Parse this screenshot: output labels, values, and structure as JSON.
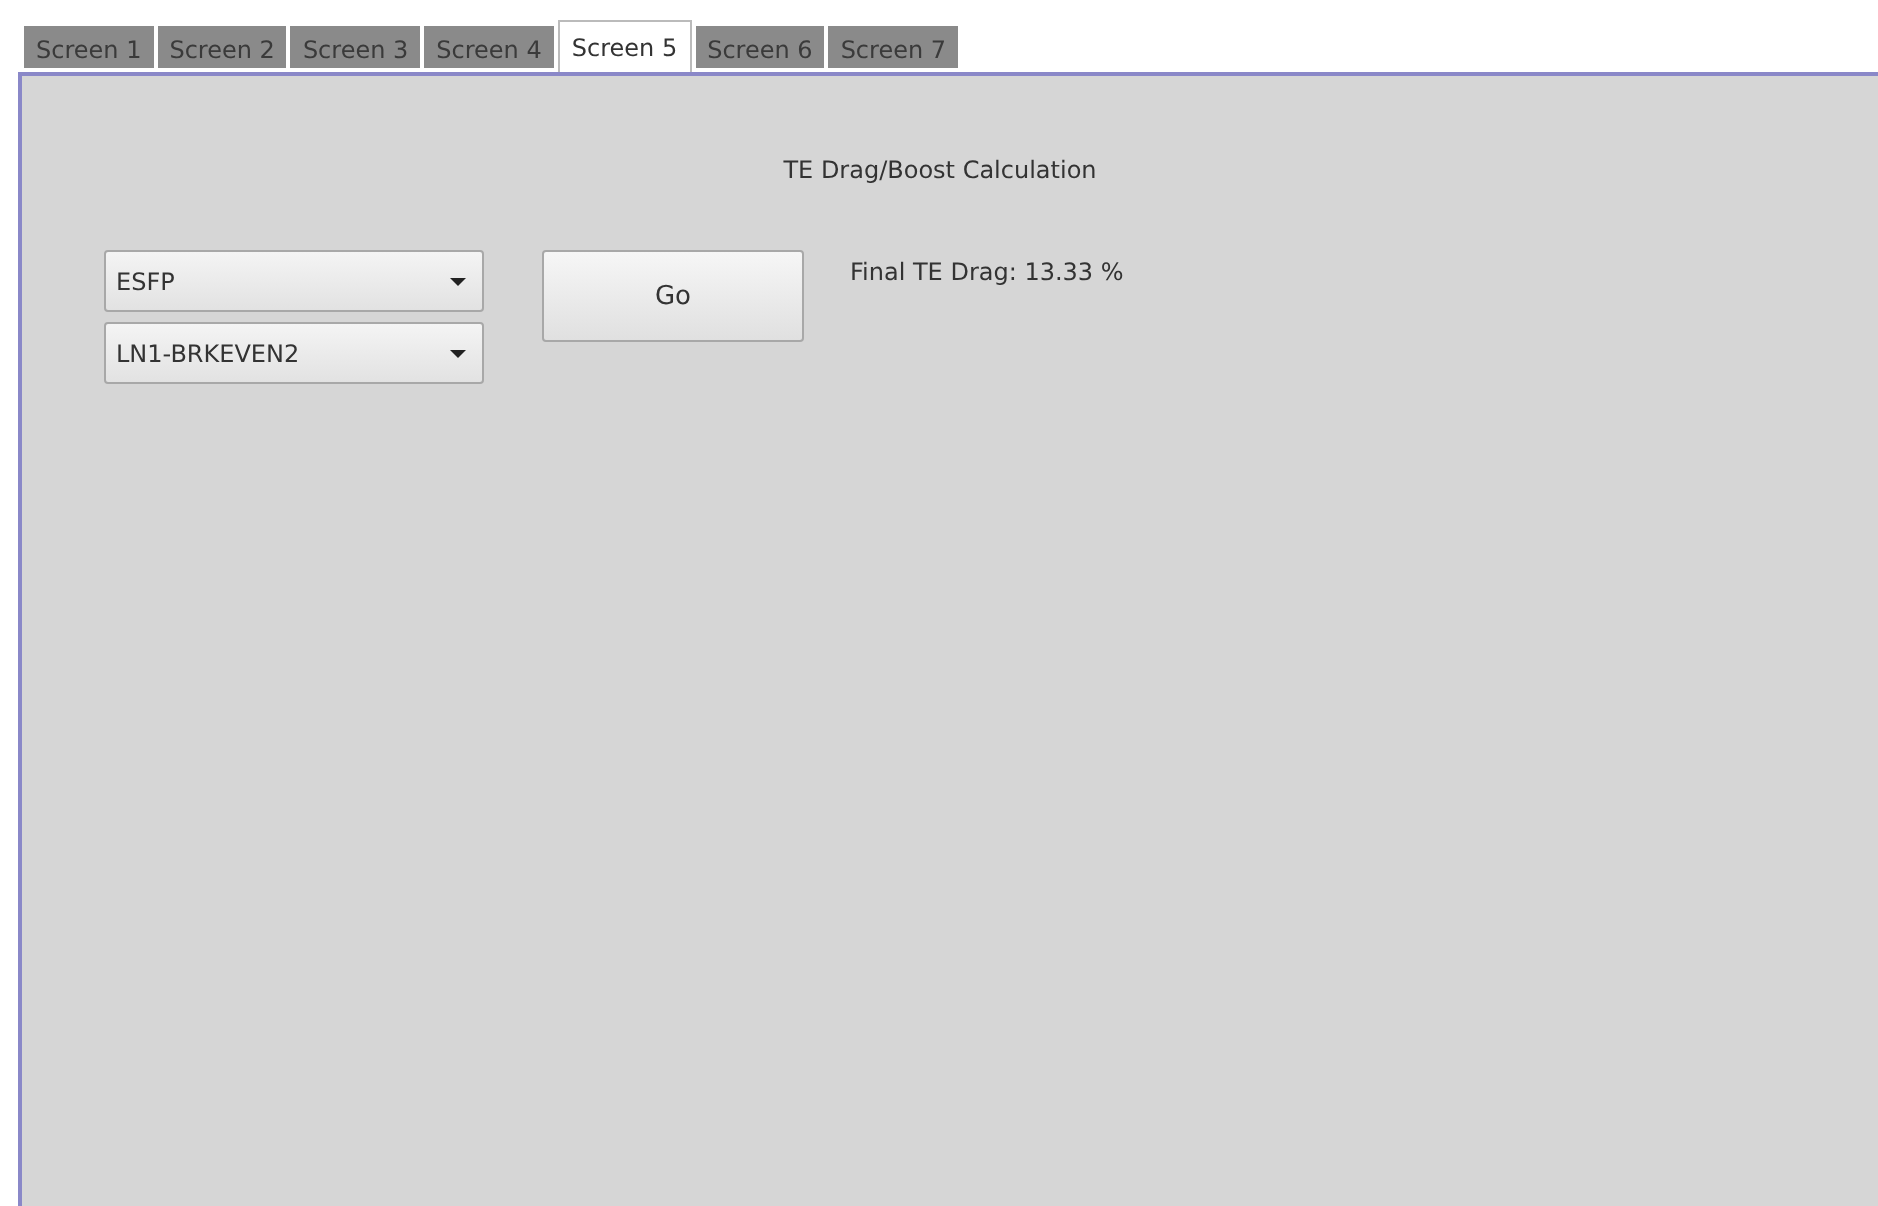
{
  "tabs": [
    {
      "label": "Screen 1",
      "selected": false
    },
    {
      "label": "Screen 2",
      "selected": false
    },
    {
      "label": "Screen 3",
      "selected": false
    },
    {
      "label": "Screen 4",
      "selected": false
    },
    {
      "label": "Screen 5",
      "selected": true
    },
    {
      "label": "Screen 6",
      "selected": false
    },
    {
      "label": "Screen 7",
      "selected": false
    }
  ],
  "panel": {
    "title": "TE Drag/Boost Calculation",
    "dropdowns": [
      {
        "value": "ESFP"
      },
      {
        "value": "LN1-BRKEVEN2"
      }
    ],
    "button": "Go",
    "result": "Final TE Drag: 13.33 %"
  }
}
